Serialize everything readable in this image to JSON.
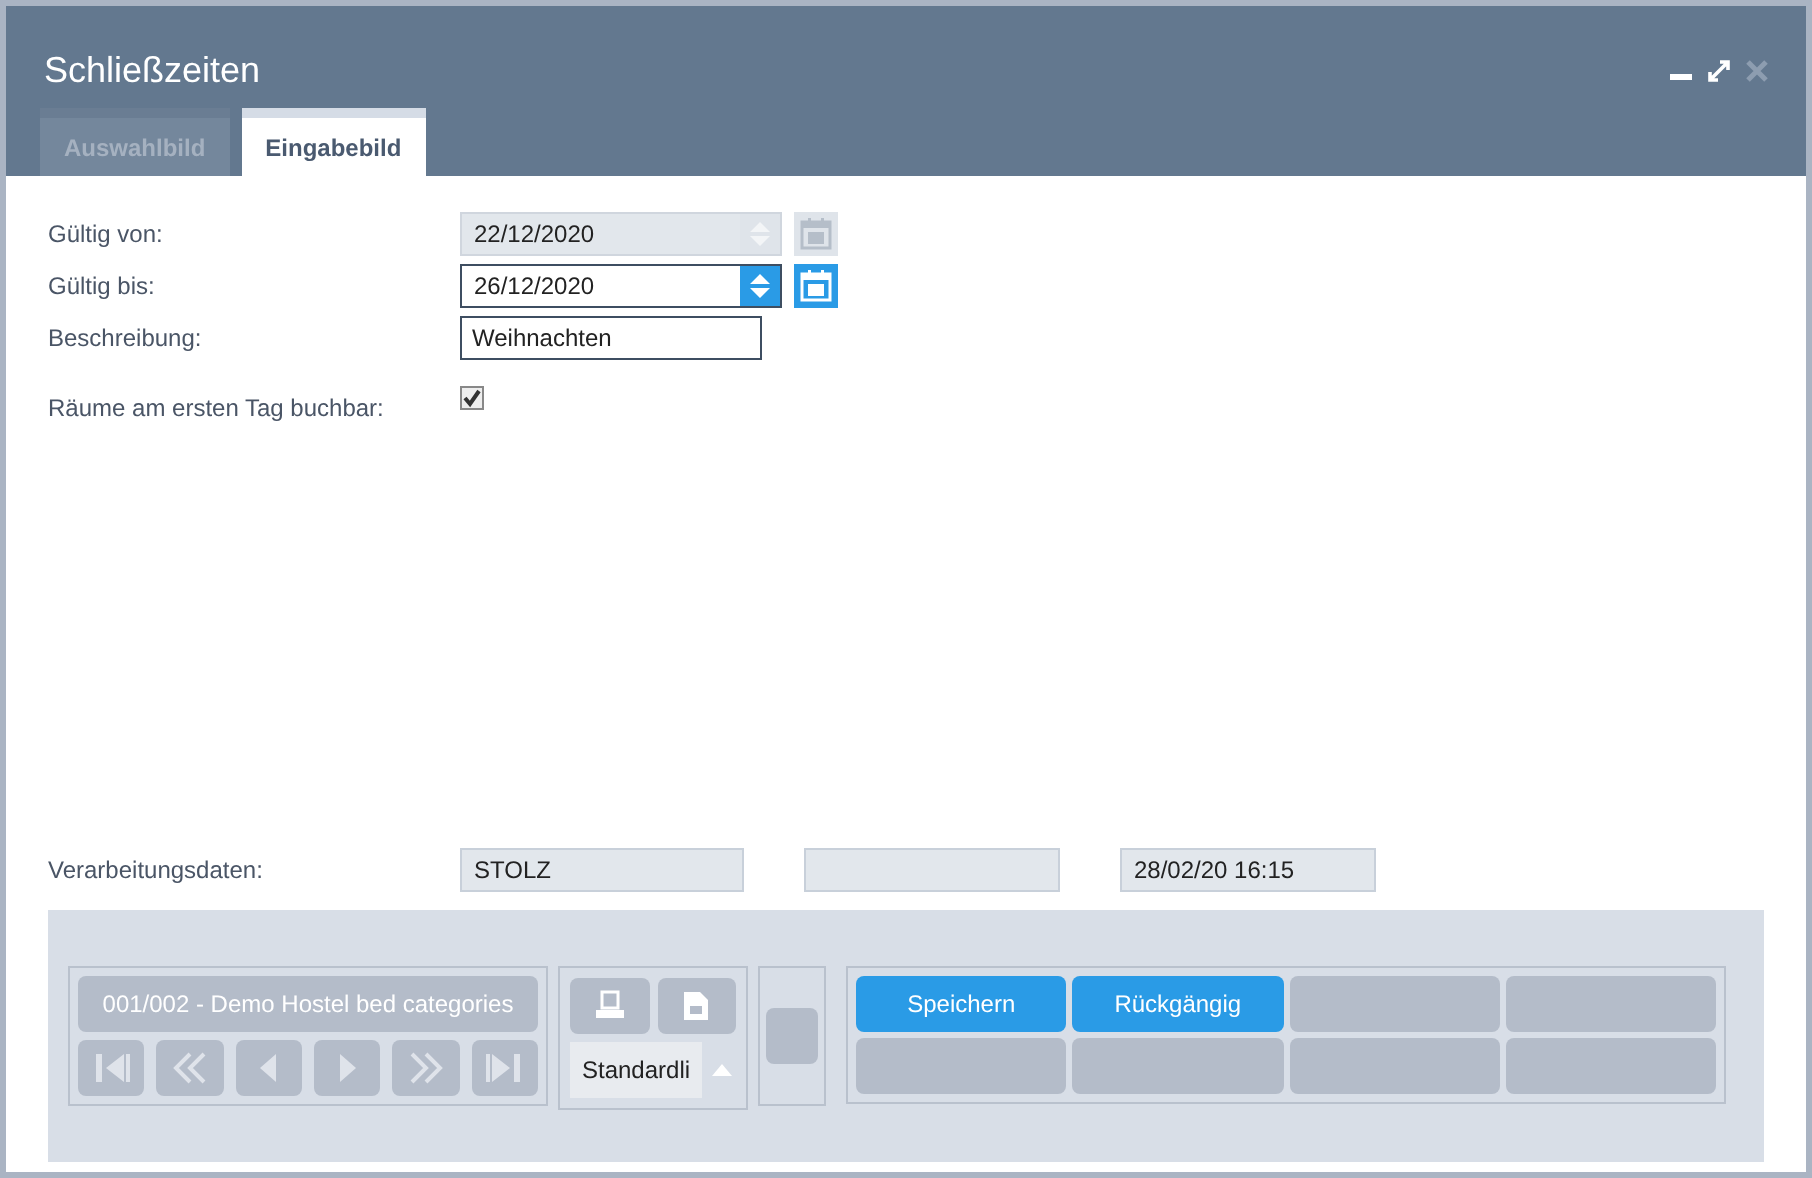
{
  "window": {
    "title": "Schließzeiten"
  },
  "tabs": [
    {
      "label": "Auswahlbild",
      "selected": false
    },
    {
      "label": "Eingabebild",
      "selected": true
    }
  ],
  "form": [
    {
      "kind": "date",
      "label": "Gültig von:",
      "value": "22/12/2020",
      "disabled": true
    },
    {
      "kind": "date",
      "label": "Gültig bis:",
      "value": "26/12/2020",
      "disabled": false
    },
    {
      "kind": "text",
      "label": "Beschreibung:",
      "value": "Weihnachten"
    },
    {
      "kind": "checkbox",
      "label": "Räume am ersten Tag buchbar:",
      "checked": true
    }
  ],
  "processing": {
    "label": "Verarbeitungsdaten:",
    "fields": [
      {
        "kind": "value",
        "value": "STOLZ"
      },
      {
        "kind": "blank"
      },
      {
        "kind": "value",
        "value": "28/02/20 16:15"
      }
    ]
  },
  "record_nav": {
    "label": "001/002 - Demo Hostel bed categories"
  },
  "list_select": {
    "value": "Standardli"
  },
  "actions": [
    {
      "label": "Speichern",
      "enabled": true
    },
    {
      "label": "Rückgängig",
      "enabled": true
    },
    {
      "enabled": false
    },
    {
      "enabled": false
    },
    {
      "enabled": false
    },
    {
      "enabled": false
    },
    {
      "enabled": false
    },
    {
      "enabled": false
    }
  ]
}
